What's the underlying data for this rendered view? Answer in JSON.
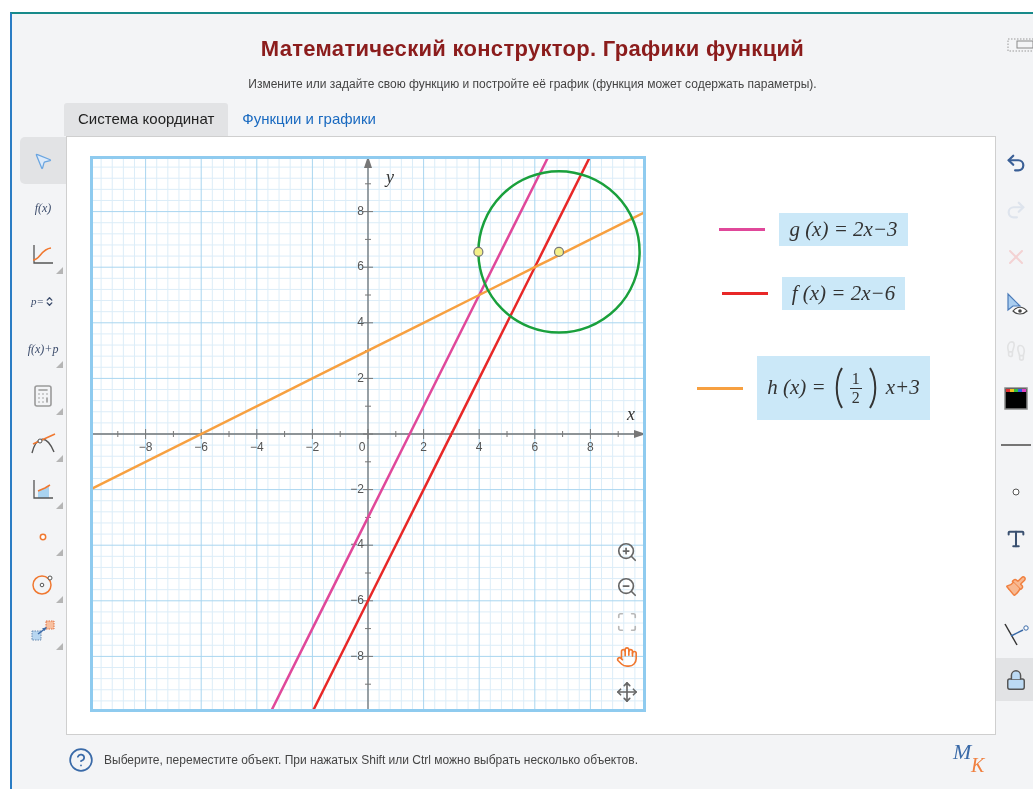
{
  "title": "Математический конструктор. Графики функций",
  "subtitle": "Измените или задайте свою функцию и постройте её график (функция может содержать параметры).",
  "tabs": [
    {
      "label": "Система координат",
      "selected": true
    },
    {
      "label": "Функции и графики",
      "selected": false
    }
  ],
  "left_tools": [
    {
      "kind": "pointer",
      "selected": true,
      "has_submenu": false
    },
    {
      "kind": "label",
      "label": "f(x)",
      "selected": false,
      "has_submenu": false
    },
    {
      "kind": "curve",
      "selected": false,
      "has_submenu": true
    },
    {
      "kind": "parameter",
      "label": "p=",
      "selected": false,
      "has_submenu": false
    },
    {
      "kind": "label",
      "label": "f(x)+p",
      "selected": false,
      "has_submenu": true
    },
    {
      "kind": "calculator",
      "selected": false,
      "has_submenu": true
    },
    {
      "kind": "tangent",
      "selected": false,
      "has_submenu": true
    },
    {
      "kind": "area",
      "selected": false,
      "has_submenu": true
    },
    {
      "kind": "point",
      "selected": false,
      "has_submenu": true
    },
    {
      "kind": "circle",
      "selected": false,
      "has_submenu": true
    },
    {
      "kind": "transform",
      "selected": false,
      "has_submenu": true
    }
  ],
  "right_tools": [
    {
      "kind": "undo",
      "disabled": false,
      "selected": false
    },
    {
      "kind": "redo",
      "disabled": true,
      "selected": false
    },
    {
      "kind": "delete",
      "disabled": true,
      "selected": false
    },
    {
      "kind": "visibility",
      "disabled": false,
      "selected": false
    },
    {
      "kind": "trace",
      "disabled": true,
      "selected": false
    },
    {
      "kind": "color",
      "disabled": false,
      "selected": false
    },
    {
      "kind": "line_style",
      "disabled": false,
      "selected": false
    },
    {
      "kind": "point_size",
      "disabled": false,
      "selected": false
    },
    {
      "kind": "text",
      "disabled": false,
      "selected": false
    },
    {
      "kind": "brush",
      "disabled": false,
      "selected": false
    },
    {
      "kind": "measure",
      "disabled": false,
      "selected": false
    },
    {
      "kind": "lock",
      "disabled": false,
      "selected": true
    }
  ],
  "graph": {
    "chart_data": {
      "type": "line",
      "xlabel": "x",
      "ylabel": "y",
      "x": [
        -10,
        -3.5,
        -2,
        0,
        2,
        4,
        6,
        6.5,
        8,
        10
      ],
      "series": [
        {
          "color": "#e0489a",
          "values": [
            null,
            -10,
            -7,
            -3,
            1,
            5,
            9,
            10,
            null,
            null
          ]
        },
        {
          "color": "#e82828",
          "values": [
            null,
            null,
            -10,
            -6,
            -2,
            2,
            6,
            7,
            10,
            null
          ]
        },
        {
          "color": "#f7a040",
          "values": [
            -2,
            1.25,
            2,
            3,
            4,
            5,
            6,
            6.25,
            7,
            8
          ]
        }
      ],
      "xlim": [
        -10,
        10
      ],
      "ylim": [
        -10,
        10
      ],
      "grid": true,
      "xticks": [
        {
          "value": -8,
          "label": "−8"
        },
        {
          "value": -6,
          "label": "−6"
        },
        {
          "value": -4,
          "label": "−4"
        },
        {
          "value": -2,
          "label": "−2"
        },
        {
          "value": 0,
          "label": "0"
        },
        {
          "value": 2,
          "label": "2"
        },
        {
          "value": 4,
          "label": "4"
        },
        {
          "value": 6,
          "label": "6"
        },
        {
          "value": 8,
          "label": "8"
        }
      ],
      "yticks": [
        {
          "value": 8,
          "label": "8"
        },
        {
          "value": 6,
          "label": "6"
        },
        {
          "value": 4,
          "label": "4"
        },
        {
          "value": 2,
          "label": "2"
        },
        {
          "value": -2,
          "label": "−2"
        },
        {
          "value": -4,
          "label": "−4"
        },
        {
          "value": -6,
          "label": "−6"
        },
        {
          "value": -8,
          "label": "−8"
        }
      ]
    },
    "view_tools": [
      {
        "kind": "zoom_in",
        "selected": false,
        "disabled": false
      },
      {
        "kind": "zoom_out",
        "selected": false,
        "disabled": false
      },
      {
        "kind": "fit",
        "selected": false,
        "disabled": true
      },
      {
        "kind": "pan",
        "selected": true,
        "disabled": false
      },
      {
        "kind": "center",
        "selected": false,
        "disabled": false
      }
    ]
  },
  "legend": [
    {
      "kind": "plain",
      "color": "#e0489a",
      "formula": "g (x) = 2x−3"
    },
    {
      "kind": "plain",
      "color": "#e82828",
      "formula": "f (x) = 2x−6"
    },
    {
      "kind": "fraction",
      "color": "#f7a040",
      "formula_start": "h (x) =",
      "numerator": "1",
      "denominator": "2",
      "formula_end": "x+3"
    }
  ],
  "status": "Выберите, переместите объект. При нажатых Shift или Ctrl можно выбрать несколько объектов.",
  "logo": {
    "letters": [
      "М",
      "К"
    ]
  }
}
